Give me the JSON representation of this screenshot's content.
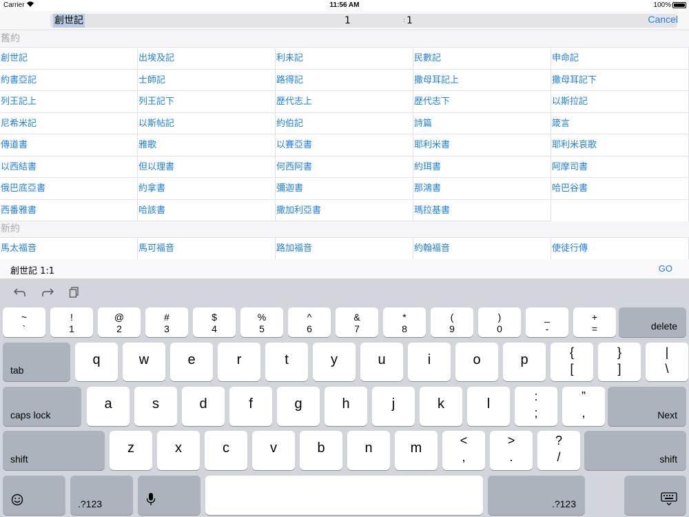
{
  "status_bar": {
    "carrier": "Carrier",
    "time": "11:56 AM",
    "battery": "100%"
  },
  "search": {
    "book": "創世記",
    "chapter": "1",
    "separator": ":",
    "verse": "1",
    "cancel_label": "Cancel"
  },
  "old_testament": {
    "header": "舊約",
    "books": [
      "創世記",
      "出埃及記",
      "利未記",
      "民數記",
      "申命記",
      "約書亞記",
      "士師記",
      "路得記",
      "撒母耳記上",
      "撒母耳記下",
      "列王記上",
      "列王記下",
      "歷代志上",
      "歷代志下",
      "以斯拉記",
      "尼希米記",
      "以斯帖記",
      "約伯記",
      "詩篇",
      "箴言",
      "傳道書",
      "雅歌",
      "以賽亞書",
      "耶利米書",
      "耶利米哀歌",
      "以西結書",
      "但以理書",
      "何西阿書",
      "約珥書",
      "阿摩司書",
      "俄巴底亞書",
      "約拿書",
      "彌迦書",
      "那鴻書",
      "哈巴谷書",
      "西番雅書",
      "哈該書",
      "撒加利亞書",
      "瑪拉基書"
    ]
  },
  "new_testament": {
    "header": "新約",
    "books": [
      "馬太福音",
      "馬可福音",
      "路加福音",
      "約翰福音",
      "使徒行傳"
    ]
  },
  "reference_bar": {
    "text": "創世記 1:1",
    "go_label": "GO"
  },
  "keyboard": {
    "number_row": [
      {
        "top": "~",
        "bottom": "`"
      },
      {
        "top": "!",
        "bottom": "1"
      },
      {
        "top": "@",
        "bottom": "2"
      },
      {
        "top": "#",
        "bottom": "3"
      },
      {
        "top": "$",
        "bottom": "4"
      },
      {
        "top": "%",
        "bottom": "5"
      },
      {
        "top": "^",
        "bottom": "6"
      },
      {
        "top": "&",
        "bottom": "7"
      },
      {
        "top": "*",
        "bottom": "8"
      },
      {
        "top": "(",
        "bottom": "9"
      },
      {
        "top": ")",
        "bottom": "0"
      },
      {
        "top": "_",
        "bottom": "-"
      },
      {
        "top": "+",
        "bottom": "="
      }
    ],
    "delete_label": "delete",
    "tab_label": "tab",
    "row_q": [
      "q",
      "w",
      "e",
      "r",
      "t",
      "y",
      "u",
      "i",
      "o",
      "p"
    ],
    "row_q_symbols": [
      {
        "top": "{",
        "bottom": "["
      },
      {
        "top": "}",
        "bottom": "]"
      },
      {
        "top": "|",
        "bottom": "\\"
      }
    ],
    "caps_label": "caps lock",
    "row_a": [
      "a",
      "s",
      "d",
      "f",
      "g",
      "h",
      "j",
      "k",
      "l"
    ],
    "row_a_symbols": [
      {
        "top": ":",
        "bottom": ";"
      },
      {
        "top": "”",
        "bottom": ","
      }
    ],
    "next_label": "Next",
    "shift_label": "shift",
    "row_z": [
      "z",
      "x",
      "c",
      "v",
      "b",
      "n",
      "m"
    ],
    "row_z_symbols": [
      {
        "top": "<",
        "bottom": ","
      },
      {
        "top": ">",
        "bottom": "."
      },
      {
        "top": "?",
        "bottom": "/"
      }
    ],
    "numbers_label": ".?123"
  }
}
